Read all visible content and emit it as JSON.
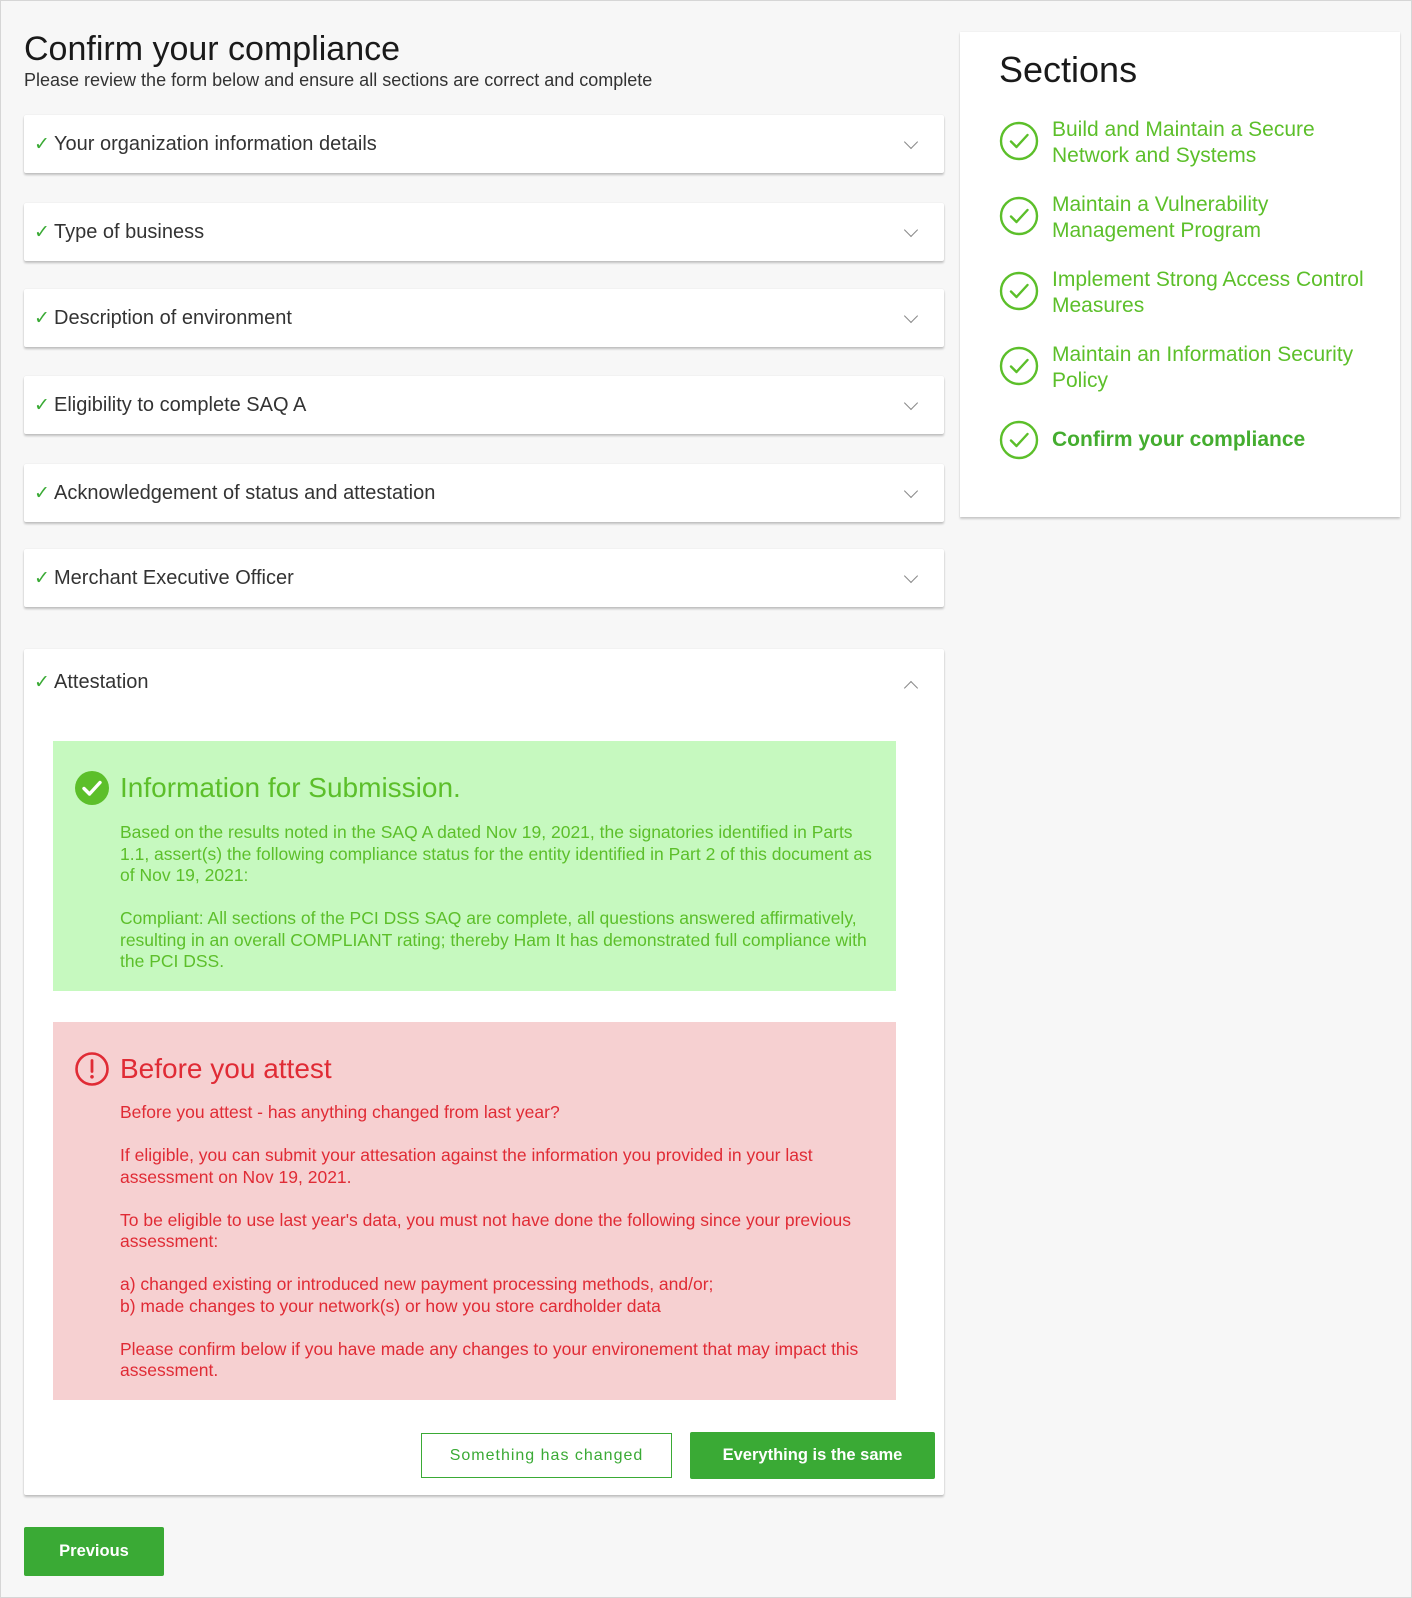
{
  "page": {
    "title": "Confirm your compliance",
    "subtitle": "Please review the form below and ensure all sections are correct and complete"
  },
  "accordion": [
    {
      "label": "Your organization information details",
      "complete": true,
      "expanded": false
    },
    {
      "label": "Type of business",
      "complete": true,
      "expanded": false
    },
    {
      "label": "Description of environment",
      "complete": true,
      "expanded": false
    },
    {
      "label": "Eligibility to complete SAQ A",
      "complete": true,
      "expanded": false
    },
    {
      "label": "Acknowledgement of status and attestation",
      "complete": true,
      "expanded": false
    },
    {
      "label": "Merchant Executive Officer",
      "complete": true,
      "expanded": false
    },
    {
      "label": "Attestation",
      "complete": true,
      "expanded": true
    }
  ],
  "check_glyph": "✓",
  "info_box": {
    "icon": "check-circle-icon",
    "title": "Information for Submission.",
    "paragraphs": [
      "Based on the results noted in the SAQ A dated Nov 19, 2021, the signatories identified in Parts 1.1, assert(s) the following compliance status for the entity identified in Part 2 of this document as of Nov 19, 2021:",
      "Compliant: All sections of the PCI DSS SAQ are complete, all questions answered affirmatively, resulting in an overall COMPLIANT rating; thereby Ham It has demonstrated full compliance with the PCI DSS."
    ]
  },
  "warning_box": {
    "icon": "exclamation-circle-icon",
    "title": "Before you attest",
    "paragraphs": [
      "Before you attest - has anything changed from last year?",
      "If eligible, you can submit your attesation against the information you provided in your last assessment on Nov 19, 2021.",
      "To be eligible to use last year's data, you must not have done the following since your previous assessment:",
      "a) changed existing or introduced new payment processing methods, and/or;",
      "b) made changes to your network(s) or how you store cardholder data",
      "Please confirm below if you have made any changes to your environement that may impact this assessment."
    ]
  },
  "buttons": {
    "something_changed": "Something has changed",
    "everything_same": "Everything is the same",
    "previous": "Previous"
  },
  "sidebar": {
    "title": "Sections",
    "items": [
      {
        "label": "Build and Maintain a Secure Network and Systems",
        "current": false
      },
      {
        "label": "Maintain a Vulnerability Management Program",
        "current": false
      },
      {
        "label": "Implement Strong Access Control Measures",
        "current": false
      },
      {
        "label": "Maintain an Information Security Policy",
        "current": false
      },
      {
        "label": "Confirm your compliance",
        "current": true
      }
    ]
  },
  "colors": {
    "brand_green": "#3aaa35",
    "success_bg": "#c6f9bf",
    "success_text": "#5cbf2a",
    "danger_bg": "#f6d0d1",
    "danger_text": "#e02b35"
  }
}
